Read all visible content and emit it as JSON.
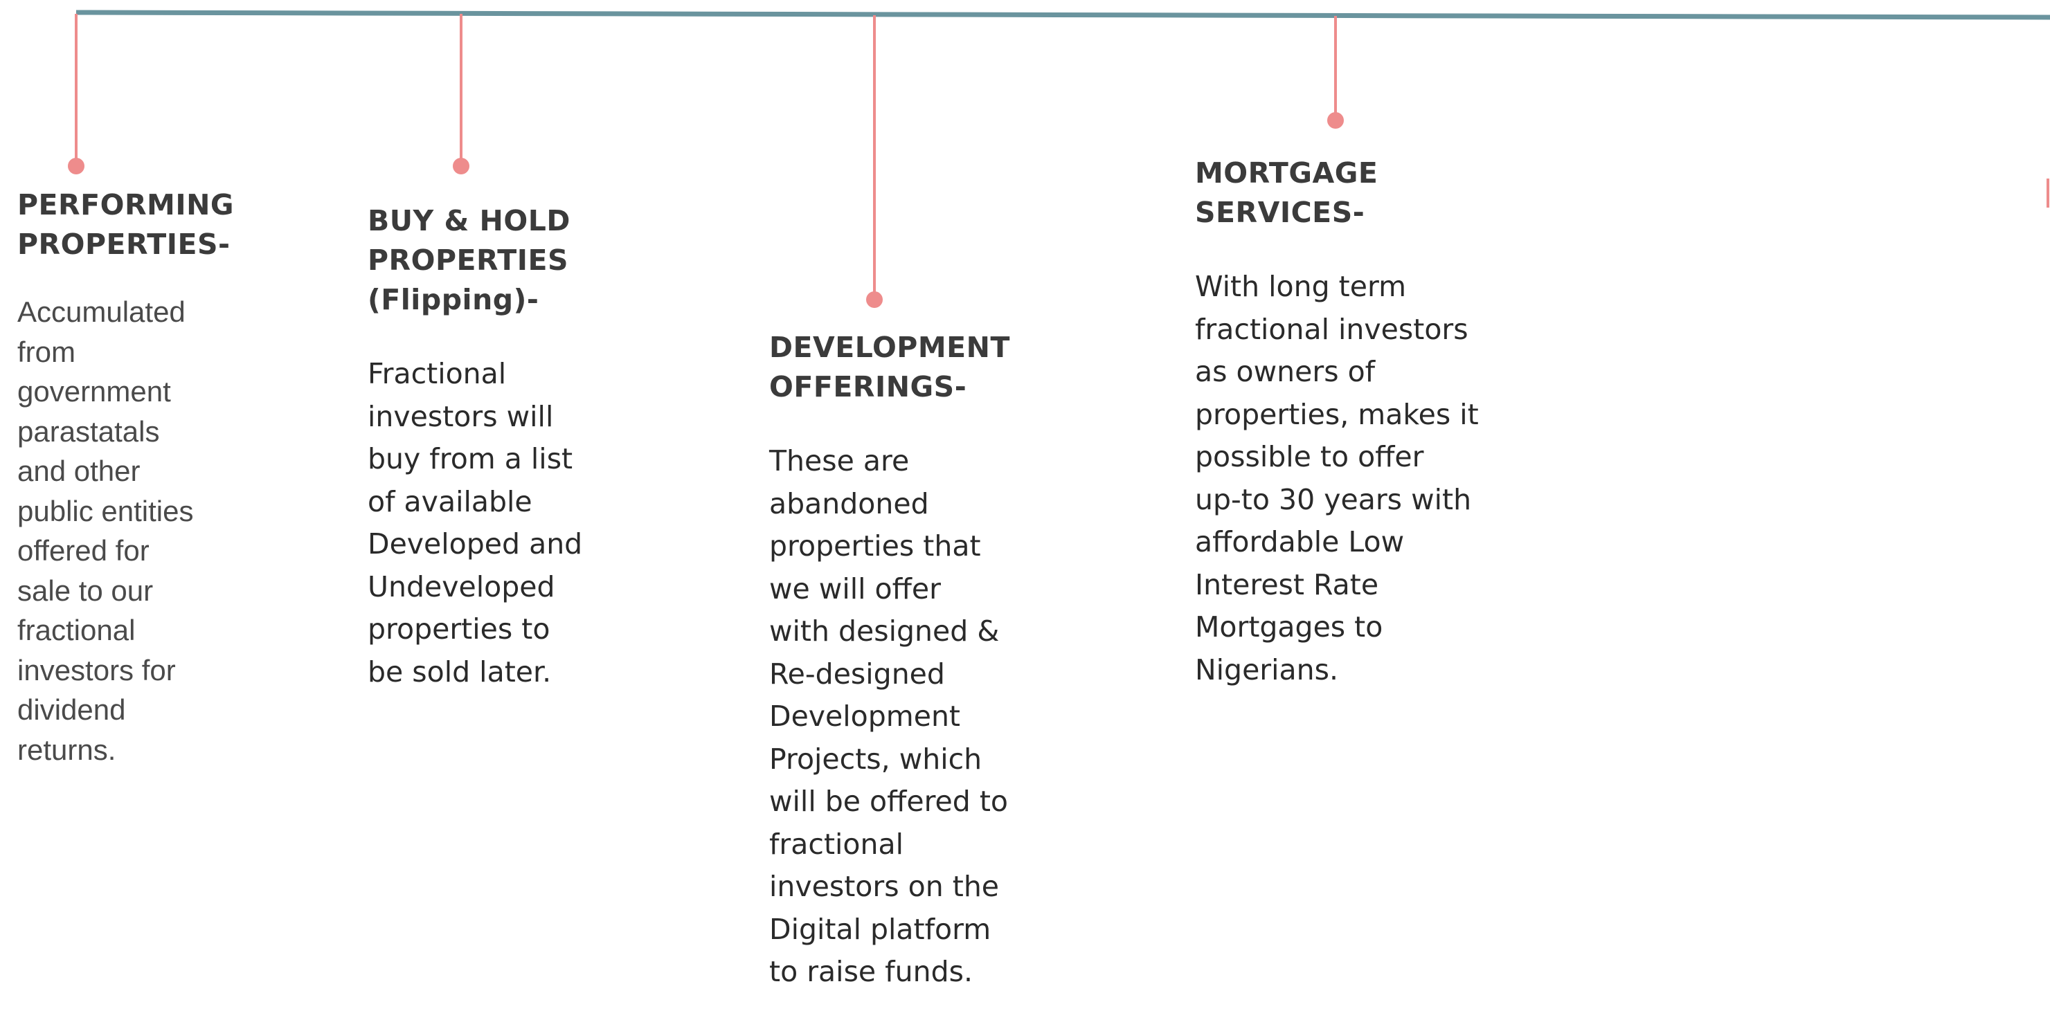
{
  "colors": {
    "timeline": "#6a949e",
    "connector": "#ee8c8c",
    "heading": "#3b3b3b",
    "body": "#2a2a2a"
  },
  "items": [
    {
      "title_lines": [
        "PERFORMING",
        "PROPERTIES-"
      ],
      "body_lines": [
        "Accumulated",
        "from",
        "government",
        "parastatals",
        "and other",
        "public entities",
        "offered for",
        "sale to our",
        "fractional",
        "investors for",
        "dividend",
        "returns."
      ]
    },
    {
      "title_lines": [
        "BUY & HOLD",
        "PROPERTIES",
        "(Flipping)-"
      ],
      "body_lines": [
        "Fractional",
        "investors will",
        "buy from a list",
        "of available",
        "Developed and",
        "Undeveloped",
        "properties to",
        "be sold later."
      ]
    },
    {
      "title_lines": [
        "DEVELOPMENT",
        "OFFERINGS-"
      ],
      "body_lines": [
        "These are",
        "abandoned",
        "properties that",
        "we will offer",
        "with  designed &",
        "Re-designed",
        "Development",
        "Projects,  which",
        "will be offered to",
        "fractional",
        "investors on the",
        "Digital platform",
        "to raise funds."
      ]
    },
    {
      "title_lines": [
        "MORTGAGE",
        "SERVICES-"
      ],
      "body_lines": [
        "With long term",
        "fractional investors",
        "as owners of",
        "properties, makes it",
        "possible to offer",
        "up-to 30 years with",
        "affordable  Low",
        "Interest Rate",
        "Mortgages to",
        "Nigerians."
      ]
    }
  ]
}
